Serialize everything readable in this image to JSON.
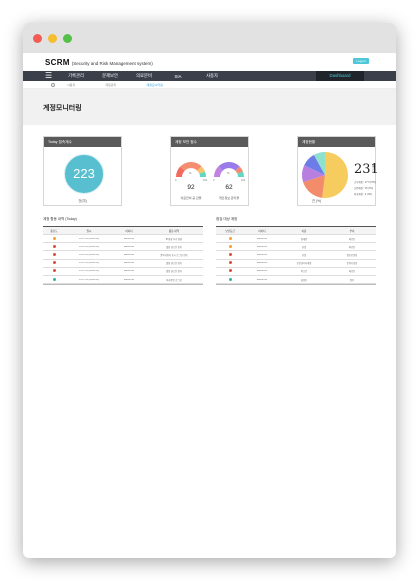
{
  "app": {
    "name": "SCRM",
    "subtitle": "(Security and Risk Management system)",
    "logout_label": "Logout"
  },
  "nav": {
    "items": [
      "기록관리",
      "문제보안",
      "의료문비",
      "SIA",
      "사용자"
    ],
    "active": "Dashboard"
  },
  "breadcrumb": [
    "사용자",
    "계정관리",
    "계정모니터링"
  ],
  "page_title": "계정모니터링",
  "cards": {
    "today": {
      "title": "Today 접속계수",
      "value": "223",
      "caption": "건(미)"
    },
    "gauges": {
      "title": "계정 보안 점수",
      "left": {
        "value": "92",
        "caption": "의료전비 공 관율",
        "pct_label": "%",
        "min": "0",
        "max": "100"
      },
      "right": {
        "value": "62",
        "caption": "개인정보 관리율",
        "pct_label": "%",
        "min": "0",
        "max": "100"
      }
    },
    "status": {
      "title": "계정현황",
      "total": "231",
      "unit": "총 건",
      "caption": "건 (%)",
      "legend": [
        "근무계정 : 177 (67%)",
        "휴면계정 : 15 (7%)",
        "퇴사계정 : 2 (1%)"
      ],
      "slices": [
        {
          "color": "#f7cc5e",
          "pct": 0.52
        },
        {
          "color": "#f28c6a",
          "pct": 0.18
        },
        {
          "color": "#b77fe0",
          "pct": 0.12
        },
        {
          "color": "#6d7de8",
          "pct": 0.1
        },
        {
          "color": "#8fe0cc",
          "pct": 0.08
        }
      ]
    }
  },
  "activity_table": {
    "title": "계정 활동 내역 (Today)",
    "columns": [
      "중요도",
      "일시",
      "아이디",
      "활동 내역"
    ],
    "rows": [
      {
        "level_color": "#f0a22a",
        "time": "14:07:01 (06/06/15)",
        "id": "abcd4012",
        "action": "IP변경 자기 변경"
      },
      {
        "level_color": "#e24b3b",
        "time": "14:07:01 (06/06/15)",
        "id": "abcd4012",
        "action": "열람 권고된 접속"
      },
      {
        "level_color": "#e24b3b",
        "time": "14:07:01 (06/06/15)",
        "id": "abcd4012",
        "action": "중복사용자 동시 로그인 접속"
      },
      {
        "level_color": "#e24b3b",
        "time": "14:07:01 (06/06/15)",
        "id": "abcd4012",
        "action": "열람 권고된 접속"
      },
      {
        "level_color": "#e24b3b",
        "time": "14:07:01 (06/06/15)",
        "id": "abcd4012",
        "action": "열람 권고된 접속"
      },
      {
        "level_color": "#2fb3a0",
        "time": "14:07:01 (06/06/15)",
        "id": "abcd4012",
        "action": "비사용된 로그인"
      }
    ]
  },
  "check_table": {
    "title": "점검 대상 계정",
    "columns": [
      "보안등급",
      "아이디",
      "이름",
      "부서"
    ],
    "rows": [
      {
        "level_color": "#f0a22a",
        "id": "abcd4012",
        "name": "정재민",
        "dept": "의료진"
      },
      {
        "level_color": "#f0a22a",
        "id": "abcd4012",
        "name": "한빛",
        "dept": "의료진"
      },
      {
        "level_color": "#e24b3b",
        "id": "abcd4012",
        "name": "한빛",
        "dept": "정보보안팀"
      },
      {
        "level_color": "#e24b3b",
        "id": "abcd4012",
        "name": "보안관리자계정",
        "dept": "운영기획팀"
      },
      {
        "level_color": "#e24b3b",
        "id": "abcd4012",
        "name": "박소은",
        "dept": "의료진"
      },
      {
        "level_color": "#2fb3a0",
        "id": "abcd4012",
        "name": "홍길동",
        "dept": "원무"
      }
    ]
  }
}
